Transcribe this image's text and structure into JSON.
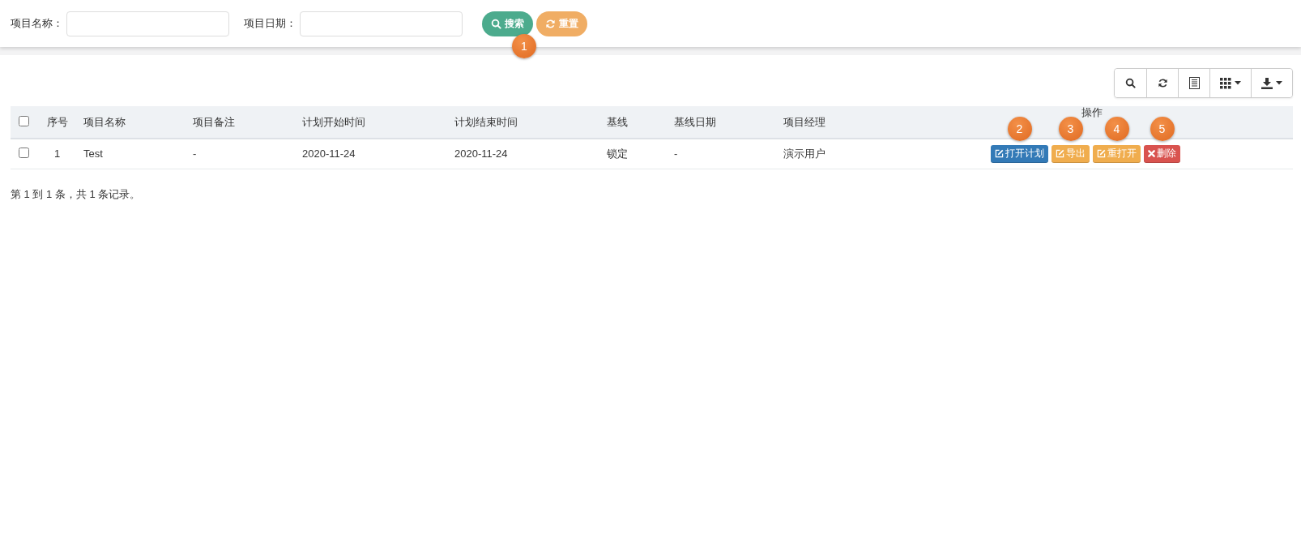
{
  "search_form": {
    "fields": [
      {
        "label": "项目名称："
      },
      {
        "label": "项目日期："
      }
    ],
    "buttons": [
      {
        "label": "搜索",
        "kind": "search",
        "callout": "1"
      },
      {
        "label": "重置",
        "kind": "reset"
      }
    ]
  },
  "toolbar": [
    {
      "kind": "search"
    },
    {
      "kind": "refresh"
    },
    {
      "kind": "list"
    },
    {
      "kind": "columns"
    },
    {
      "kind": "export"
    }
  ],
  "table": {
    "header_checked": false,
    "columns": [
      {
        "label": "序号"
      },
      {
        "label": "项目名称"
      },
      {
        "label": "项目备注"
      },
      {
        "label": "计划开始时间"
      },
      {
        "label": "计划结束时间"
      },
      {
        "label": "基线"
      },
      {
        "label": "基线日期"
      },
      {
        "label": "项目经理"
      },
      {
        "label": "操作"
      }
    ],
    "rows": [
      {
        "checked": false,
        "cells": [
          "1",
          "Test",
          "-",
          "2020-11-24",
          "2020-11-24",
          "锁定",
          "-",
          "演示用户"
        ],
        "actions": [
          {
            "label": "打开计划",
            "kind": "primary",
            "callout": "2"
          },
          {
            "label": "导出",
            "kind": "warning",
            "callout": "3"
          },
          {
            "label": "重打开",
            "kind": "warning",
            "callout": "4"
          },
          {
            "label": "删除",
            "kind": "danger",
            "callout": "5"
          }
        ]
      }
    ]
  },
  "pagination": {
    "summary": "第 1 到 1 条，共 1 条记录。"
  }
}
